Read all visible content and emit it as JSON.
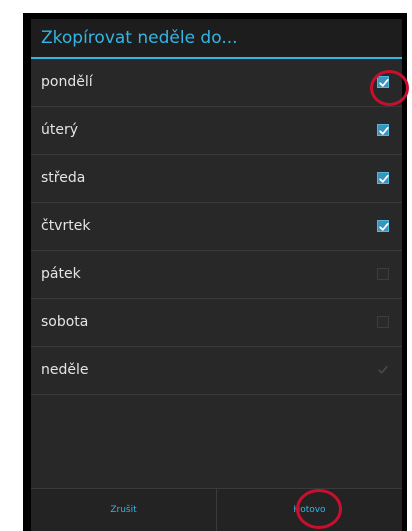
{
  "dialog": {
    "title": "Zkopírovat neděle do...",
    "accent_color": "#33b5e5",
    "items": [
      {
        "label": "pondělí",
        "state": "checked"
      },
      {
        "label": "úterý",
        "state": "checked"
      },
      {
        "label": "středa",
        "state": "checked"
      },
      {
        "label": "čtvrtek",
        "state": "checked"
      },
      {
        "label": "pátek",
        "state": "unchecked"
      },
      {
        "label": "sobota",
        "state": "unchecked"
      },
      {
        "label": "neděle",
        "state": "disabled-checked"
      }
    ],
    "buttons": {
      "cancel_label": "Zrušit",
      "done_label": "Hotovo"
    }
  },
  "annotations": {
    "highlight_color": "#c8102e",
    "highlighted": [
      "pondělí checkbox",
      "Hotovo button"
    ]
  }
}
